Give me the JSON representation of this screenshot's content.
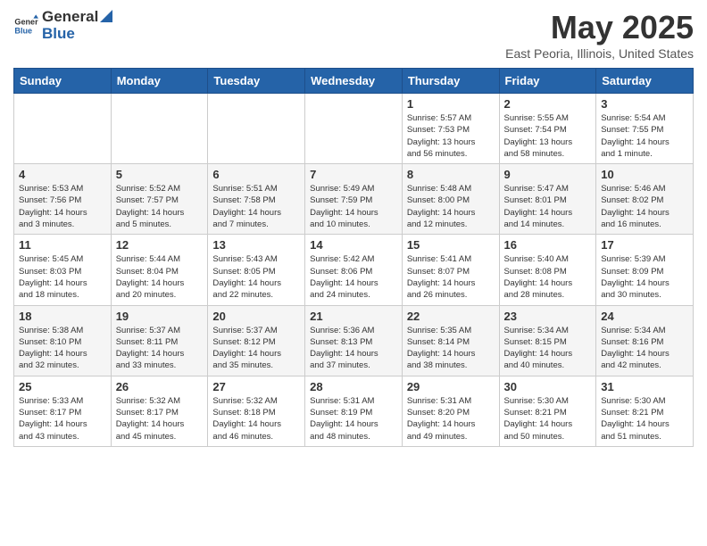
{
  "header": {
    "logo_general": "General",
    "logo_blue": "Blue",
    "title": "May 2025",
    "subtitle": "East Peoria, Illinois, United States"
  },
  "weekdays": [
    "Sunday",
    "Monday",
    "Tuesday",
    "Wednesday",
    "Thursday",
    "Friday",
    "Saturday"
  ],
  "weeks": [
    [
      {
        "day": "",
        "info": ""
      },
      {
        "day": "",
        "info": ""
      },
      {
        "day": "",
        "info": ""
      },
      {
        "day": "",
        "info": ""
      },
      {
        "day": "1",
        "info": "Sunrise: 5:57 AM\nSunset: 7:53 PM\nDaylight: 13 hours\nand 56 minutes."
      },
      {
        "day": "2",
        "info": "Sunrise: 5:55 AM\nSunset: 7:54 PM\nDaylight: 13 hours\nand 58 minutes."
      },
      {
        "day": "3",
        "info": "Sunrise: 5:54 AM\nSunset: 7:55 PM\nDaylight: 14 hours\nand 1 minute."
      }
    ],
    [
      {
        "day": "4",
        "info": "Sunrise: 5:53 AM\nSunset: 7:56 PM\nDaylight: 14 hours\nand 3 minutes."
      },
      {
        "day": "5",
        "info": "Sunrise: 5:52 AM\nSunset: 7:57 PM\nDaylight: 14 hours\nand 5 minutes."
      },
      {
        "day": "6",
        "info": "Sunrise: 5:51 AM\nSunset: 7:58 PM\nDaylight: 14 hours\nand 7 minutes."
      },
      {
        "day": "7",
        "info": "Sunrise: 5:49 AM\nSunset: 7:59 PM\nDaylight: 14 hours\nand 10 minutes."
      },
      {
        "day": "8",
        "info": "Sunrise: 5:48 AM\nSunset: 8:00 PM\nDaylight: 14 hours\nand 12 minutes."
      },
      {
        "day": "9",
        "info": "Sunrise: 5:47 AM\nSunset: 8:01 PM\nDaylight: 14 hours\nand 14 minutes."
      },
      {
        "day": "10",
        "info": "Sunrise: 5:46 AM\nSunset: 8:02 PM\nDaylight: 14 hours\nand 16 minutes."
      }
    ],
    [
      {
        "day": "11",
        "info": "Sunrise: 5:45 AM\nSunset: 8:03 PM\nDaylight: 14 hours\nand 18 minutes."
      },
      {
        "day": "12",
        "info": "Sunrise: 5:44 AM\nSunset: 8:04 PM\nDaylight: 14 hours\nand 20 minutes."
      },
      {
        "day": "13",
        "info": "Sunrise: 5:43 AM\nSunset: 8:05 PM\nDaylight: 14 hours\nand 22 minutes."
      },
      {
        "day": "14",
        "info": "Sunrise: 5:42 AM\nSunset: 8:06 PM\nDaylight: 14 hours\nand 24 minutes."
      },
      {
        "day": "15",
        "info": "Sunrise: 5:41 AM\nSunset: 8:07 PM\nDaylight: 14 hours\nand 26 minutes."
      },
      {
        "day": "16",
        "info": "Sunrise: 5:40 AM\nSunset: 8:08 PM\nDaylight: 14 hours\nand 28 minutes."
      },
      {
        "day": "17",
        "info": "Sunrise: 5:39 AM\nSunset: 8:09 PM\nDaylight: 14 hours\nand 30 minutes."
      }
    ],
    [
      {
        "day": "18",
        "info": "Sunrise: 5:38 AM\nSunset: 8:10 PM\nDaylight: 14 hours\nand 32 minutes."
      },
      {
        "day": "19",
        "info": "Sunrise: 5:37 AM\nSunset: 8:11 PM\nDaylight: 14 hours\nand 33 minutes."
      },
      {
        "day": "20",
        "info": "Sunrise: 5:37 AM\nSunset: 8:12 PM\nDaylight: 14 hours\nand 35 minutes."
      },
      {
        "day": "21",
        "info": "Sunrise: 5:36 AM\nSunset: 8:13 PM\nDaylight: 14 hours\nand 37 minutes."
      },
      {
        "day": "22",
        "info": "Sunrise: 5:35 AM\nSunset: 8:14 PM\nDaylight: 14 hours\nand 38 minutes."
      },
      {
        "day": "23",
        "info": "Sunrise: 5:34 AM\nSunset: 8:15 PM\nDaylight: 14 hours\nand 40 minutes."
      },
      {
        "day": "24",
        "info": "Sunrise: 5:34 AM\nSunset: 8:16 PM\nDaylight: 14 hours\nand 42 minutes."
      }
    ],
    [
      {
        "day": "25",
        "info": "Sunrise: 5:33 AM\nSunset: 8:17 PM\nDaylight: 14 hours\nand 43 minutes."
      },
      {
        "day": "26",
        "info": "Sunrise: 5:32 AM\nSunset: 8:17 PM\nDaylight: 14 hours\nand 45 minutes."
      },
      {
        "day": "27",
        "info": "Sunrise: 5:32 AM\nSunset: 8:18 PM\nDaylight: 14 hours\nand 46 minutes."
      },
      {
        "day": "28",
        "info": "Sunrise: 5:31 AM\nSunset: 8:19 PM\nDaylight: 14 hours\nand 48 minutes."
      },
      {
        "day": "29",
        "info": "Sunrise: 5:31 AM\nSunset: 8:20 PM\nDaylight: 14 hours\nand 49 minutes."
      },
      {
        "day": "30",
        "info": "Sunrise: 5:30 AM\nSunset: 8:21 PM\nDaylight: 14 hours\nand 50 minutes."
      },
      {
        "day": "31",
        "info": "Sunrise: 5:30 AM\nSunset: 8:21 PM\nDaylight: 14 hours\nand 51 minutes."
      }
    ]
  ]
}
